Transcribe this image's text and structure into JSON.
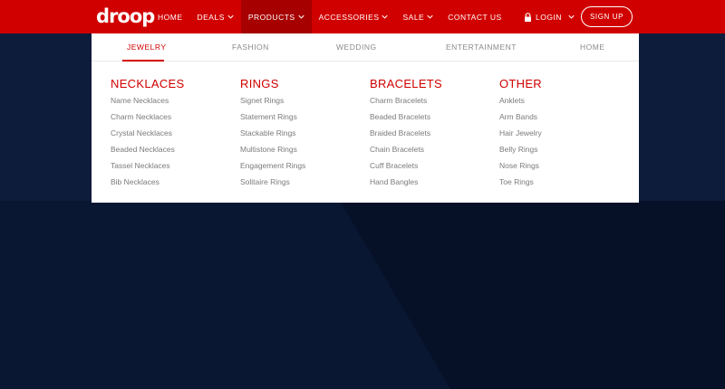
{
  "brand": {
    "logo_text": "droop",
    "accent": "#d10000"
  },
  "nav": {
    "items": [
      {
        "label": "HOME",
        "has_dropdown": false
      },
      {
        "label": "DEALS",
        "has_dropdown": true
      },
      {
        "label": "PRODUCTS",
        "has_dropdown": true,
        "active": true
      },
      {
        "label": "ACCESSORIES",
        "has_dropdown": true
      },
      {
        "label": "SALE",
        "has_dropdown": true
      },
      {
        "label": "CONTACT US",
        "has_dropdown": false
      }
    ],
    "login_label": "LOGIN",
    "signup_label": "SIGN UP",
    "icons": {
      "login": "lock-icon",
      "dropdown": "chevron-down-icon"
    }
  },
  "mega_menu": {
    "tabs": [
      {
        "label": "JEWELRY",
        "active": true
      },
      {
        "label": "FASHION",
        "active": false
      },
      {
        "label": "WEDDING",
        "active": false
      },
      {
        "label": "ENTERTAINMENT",
        "active": false
      },
      {
        "label": "HOME",
        "active": false
      }
    ],
    "columns": [
      {
        "title": "NECKLACES",
        "links": [
          "Name Necklaces",
          "Charm Necklaces",
          "Crystal Necklaces",
          "Beaded Necklaces",
          "Tassel Necklaces",
          "Bib Necklaces"
        ]
      },
      {
        "title": "RINGS",
        "links": [
          "Signet Rings",
          "Statement Rings",
          "Stackable Rings",
          "Multistone Rings",
          "Engagement Rings",
          "Solitaire Rings"
        ]
      },
      {
        "title": "BRACELETS",
        "links": [
          "Charm Bracelets",
          "Beaded Bracelets",
          "Braided Bracelets",
          "Chain Bracelets",
          "Cuff Bracelets",
          "Hand Bangles"
        ]
      },
      {
        "title": "OTHER",
        "links": [
          "Anklets",
          "Arm Bands",
          "Hair Jewelry",
          "Belly Rings",
          "Nose Rings",
          "Toe Rings"
        ]
      }
    ]
  }
}
